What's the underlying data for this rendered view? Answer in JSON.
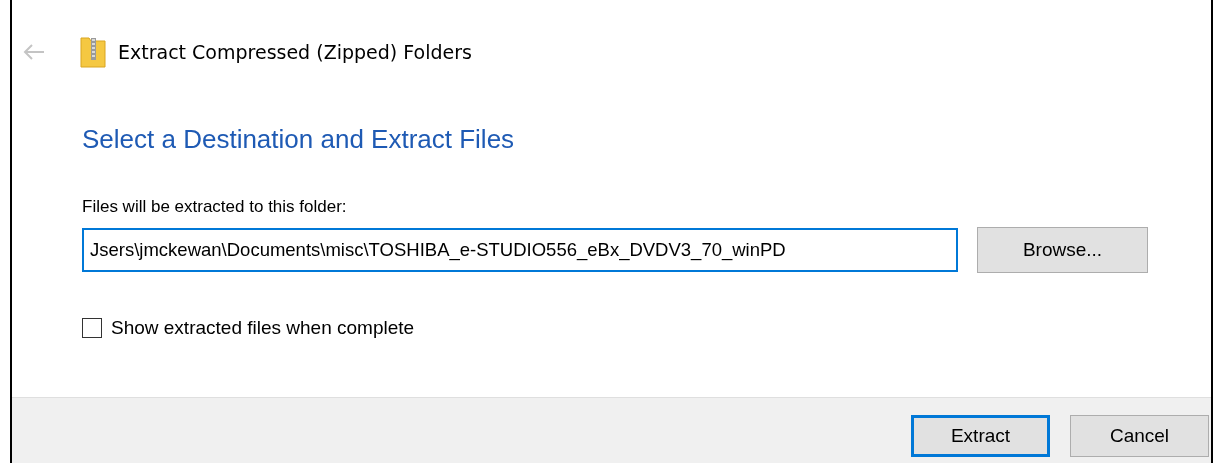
{
  "window": {
    "title": "Extract Compressed (Zipped) Folders"
  },
  "heading": "Select a Destination and Extract Files",
  "destination": {
    "label": "Files will be extracted to this folder:",
    "value": "Jsers\\jmckewan\\Documents\\misc\\TOSHIBA_e-STUDIO556_eBx_DVDV3_70_winPD",
    "focused": true,
    "browse": "Browse..."
  },
  "show_files": {
    "label": "Show extracted files when complete",
    "checked": false
  },
  "buttons": [
    {
      "label": "Extract",
      "default": true
    },
    {
      "label": "Cancel",
      "default": false
    }
  ]
}
